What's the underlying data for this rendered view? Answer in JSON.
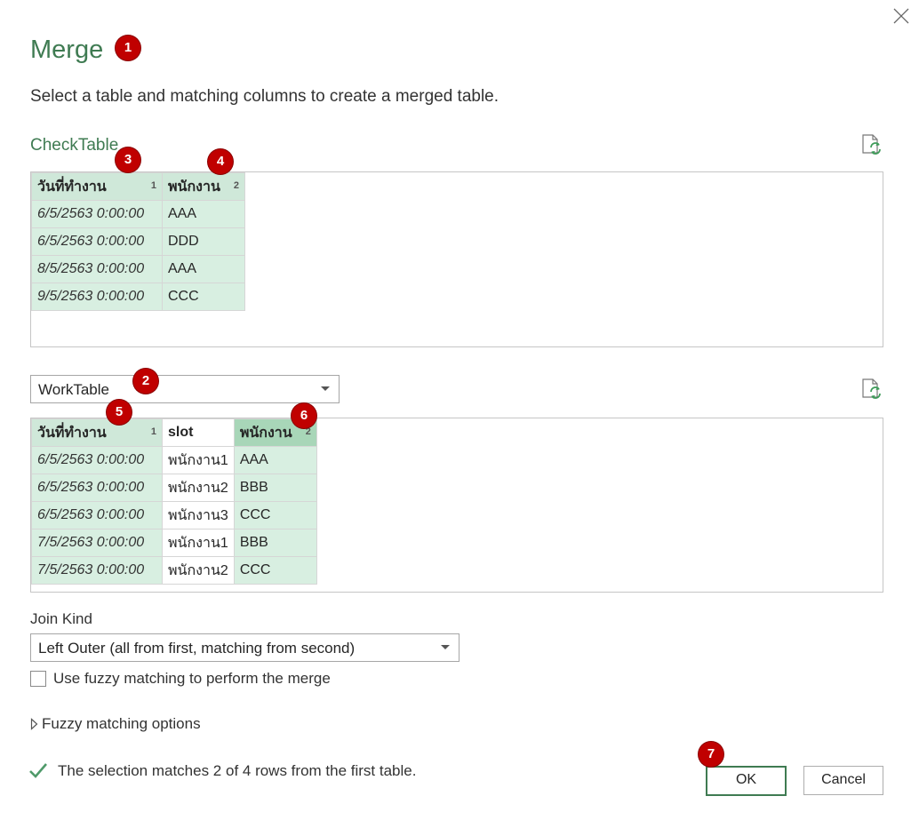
{
  "dialog": {
    "title": "Merge",
    "subtitle": "Select a table and matching columns to create a merged table."
  },
  "first_table": {
    "name": "CheckTable",
    "columns": [
      {
        "label": "วันที่ทำงาน",
        "index": "1"
      },
      {
        "label": "พนักงาน",
        "index": "2"
      }
    ],
    "rows": [
      [
        "6/5/2563 0:00:00",
        "AAA"
      ],
      [
        "6/5/2563 0:00:00",
        "DDD"
      ],
      [
        "8/5/2563 0:00:00",
        "AAA"
      ],
      [
        "9/5/2563 0:00:00",
        "CCC"
      ]
    ]
  },
  "second_table": {
    "selected": "WorkTable",
    "columns": [
      {
        "label": "วันที่ทำงาน",
        "index": "1"
      },
      {
        "label": "slot",
        "index": ""
      },
      {
        "label": "พนักงาน",
        "index": "2"
      }
    ],
    "rows": [
      [
        "6/5/2563 0:00:00",
        "พนักงาน1",
        "AAA"
      ],
      [
        "6/5/2563 0:00:00",
        "พนักงาน2",
        "BBB"
      ],
      [
        "6/5/2563 0:00:00",
        "พนักงาน3",
        "CCC"
      ],
      [
        "7/5/2563 0:00:00",
        "พนักงาน1",
        "BBB"
      ],
      [
        "7/5/2563 0:00:00",
        "พนักงาน2",
        "CCC"
      ]
    ]
  },
  "join": {
    "label": "Join Kind",
    "selected": "Left Outer (all from first, matching from second)"
  },
  "fuzzy": {
    "checkbox_label": "Use fuzzy matching to perform the merge",
    "checked": false,
    "options_label": "Fuzzy matching options"
  },
  "status": {
    "message": "The selection matches 2 of 4 rows from the first table."
  },
  "buttons": {
    "ok": "OK",
    "cancel": "Cancel"
  },
  "badges": [
    "1",
    "2",
    "3",
    "4",
    "5",
    "6",
    "7"
  ],
  "colors": {
    "accent": "#3f7b52",
    "selected_column": "#d8efe1",
    "badge": "#c00000"
  },
  "icons": {
    "close": "close-icon",
    "refresh": "refresh-preview-icon",
    "check": "check-icon",
    "expand": "expand-triangle-icon"
  }
}
